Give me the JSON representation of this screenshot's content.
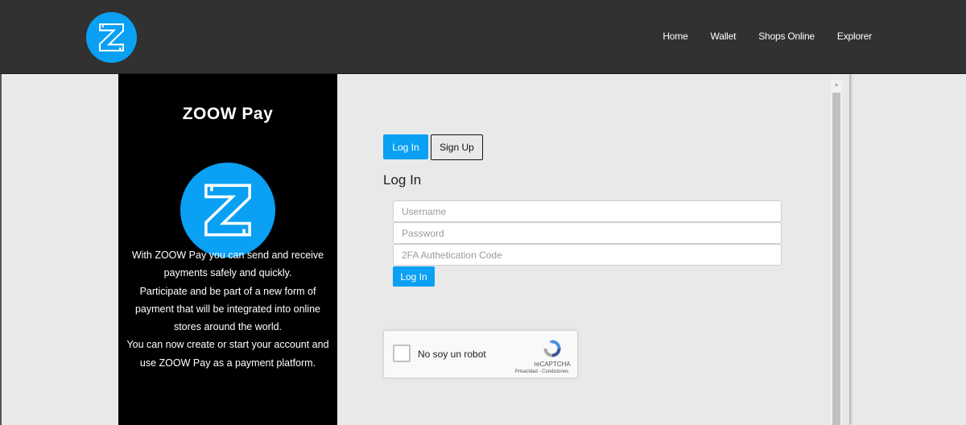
{
  "header": {
    "nav": [
      {
        "label": "Home"
      },
      {
        "label": "Wallet"
      },
      {
        "label": "Shops Online"
      },
      {
        "label": "Explorer"
      }
    ]
  },
  "sidebar": {
    "title": "ZOOW Pay",
    "text_lines": [
      "With ZOOW Pay you can send and receive",
      "payments safely and quickly.",
      "Participate and be part of a new form of",
      "payment that will be integrated into online",
      "stores around the world.",
      "You can now create or start your account and",
      "use ZOOW Pay as a payment platform."
    ]
  },
  "tabs": {
    "login_label": "Log In",
    "signup_label": "Sign Up"
  },
  "form": {
    "title": "Log In",
    "username_placeholder": "Username",
    "password_placeholder": "Password",
    "twofa_placeholder": "2FA Authetication Code",
    "submit_label": "Log In"
  },
  "captcha": {
    "label": "No soy un robot",
    "brand": "reCAPTCHA",
    "links": "Privacidad - Condiciones"
  },
  "colors": {
    "accent": "#0aa0f3",
    "topbar": "#313131",
    "sidebar_bg": "#000000",
    "panel_bg": "#e9e9e9"
  },
  "icons": {
    "logo": "z-logo-icon",
    "captcha": "recaptcha-icon",
    "scroll_up": "scroll-up-arrow-icon"
  }
}
